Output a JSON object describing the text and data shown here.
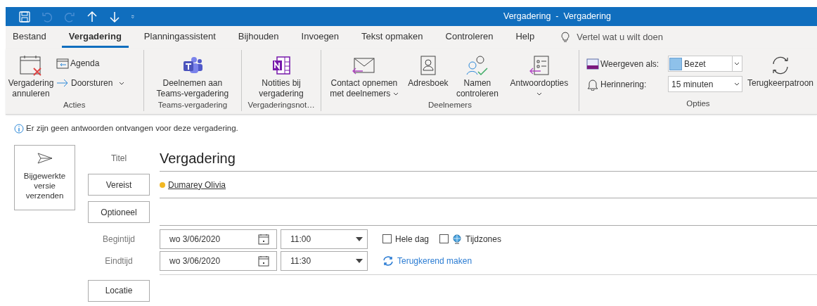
{
  "window": {
    "title": "Vergadering  -  Vergadering"
  },
  "quick_access": [
    {
      "kind": "save",
      "disabled": false
    },
    {
      "kind": "undo",
      "disabled": true
    },
    {
      "kind": "redo",
      "disabled": true
    },
    {
      "kind": "up",
      "disabled": false
    },
    {
      "kind": "down",
      "disabled": false
    },
    {
      "kind": "customize",
      "disabled": false
    }
  ],
  "tabs": [
    {
      "label": "Bestand",
      "selected": false
    },
    {
      "label": "Vergadering",
      "selected": true
    },
    {
      "label": "Planningassistent",
      "selected": false
    },
    {
      "label": "Bijhouden",
      "selected": false
    },
    {
      "label": "Invoegen",
      "selected": false
    },
    {
      "label": "Tekst opmaken",
      "selected": false
    },
    {
      "label": "Controleren",
      "selected": false
    },
    {
      "label": "Help",
      "selected": false
    }
  ],
  "tell_me": {
    "placeholder": "Vertel wat u wilt doen"
  },
  "ribbon": {
    "acties": {
      "label": "Acties",
      "cancel": "Vergadering annuleren",
      "agenda": "Agenda",
      "forward": "Doorsturen"
    },
    "teams": {
      "label": "Teams-vergadering",
      "join": "Deelnemen aan Teams-vergadering"
    },
    "notes": {
      "label": "Vergaderingsnot…",
      "button": "Notities bij vergadering"
    },
    "attendees": {
      "label": "Deelnemers",
      "contact": "Contact opnemen met deelnemers",
      "address_book": "Adresboek",
      "check_names": "Namen controleren",
      "response_options": "Antwoordopties"
    },
    "options": {
      "label": "Opties",
      "show_as_label": "Weergeven als:",
      "show_as": "Bezet",
      "reminder_label": "Herinnering:",
      "reminder": "15 minuten",
      "recurrence": "Terugkeerpatroon"
    }
  },
  "info_bar": "Er zijn geen antwoorden ontvangen voor deze vergadering.",
  "send_button": "Bijgewerkte versie verzenden",
  "form": {
    "title_label": "Titel",
    "title": "Vergadering",
    "required_button": "Vereist",
    "required_attendees": [
      {
        "name": "Dumarey Olivia",
        "color": "#f2b824"
      }
    ],
    "optional_button": "Optioneel",
    "start_label": "Begintijd",
    "start_date": "wo 3/06/2020",
    "start_time": "11:00",
    "end_label": "Eindtijd",
    "end_date": "wo 3/06/2020",
    "end_time": "11:30",
    "all_day": {
      "label": "Hele dag",
      "checked": false
    },
    "time_zones": {
      "label": "Tijdzones",
      "checked": false
    },
    "recurring_link": "Terugkerend maken",
    "location_button": "Locatie"
  }
}
